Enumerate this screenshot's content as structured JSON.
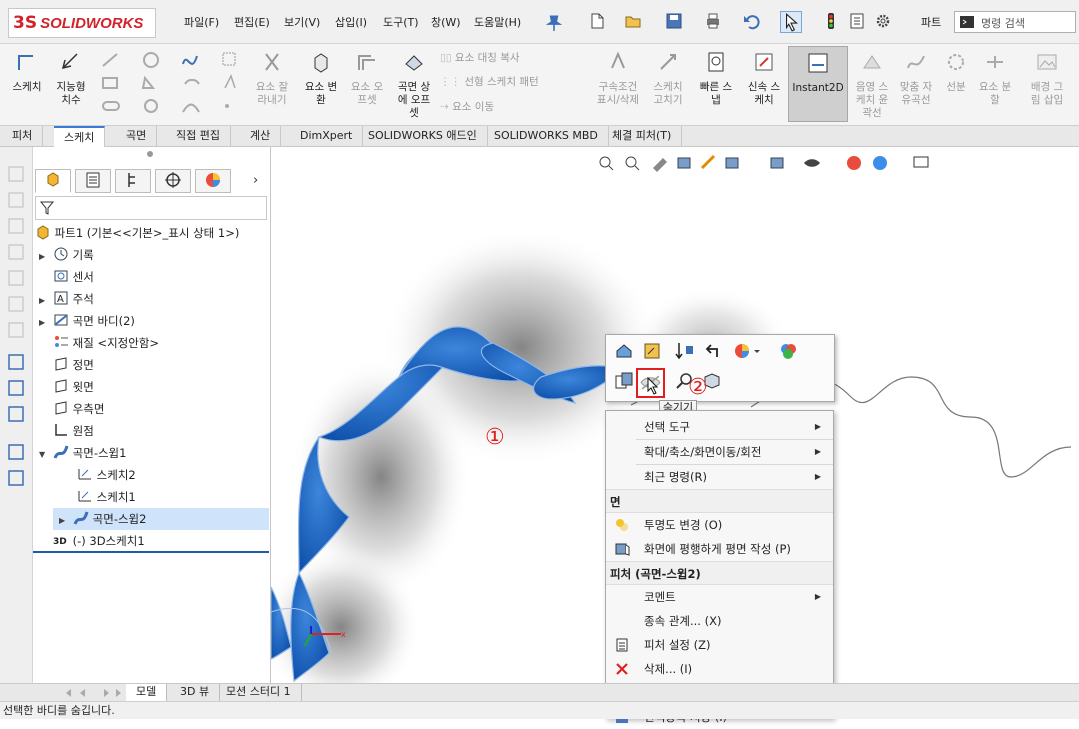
{
  "app": {
    "brand": "SOLIDWORKS",
    "brand_prefix": "3S"
  },
  "menu": [
    "파일(F)",
    "편집(E)",
    "보기(V)",
    "삽입(I)",
    "도구(T)",
    "창(W)",
    "도움말(H)"
  ],
  "titlebar": {
    "doc_type": "파트",
    "search_placeholder": "명령 검색"
  },
  "ribbon": {
    "sketch": "스케치",
    "smart_dim": [
      "지능형",
      "치수"
    ],
    "trim": [
      "요소 잘",
      "라내기"
    ],
    "convert": [
      "요소 변",
      "환"
    ],
    "offset": [
      "요소 오",
      "프셋"
    ],
    "surface_offset": [
      "곡면 상",
      "에 오프",
      "셋"
    ],
    "mirror": "요소 대칭 복사",
    "linear_pattern": "선형 스케치 패턴",
    "move": "요소 이동",
    "relations": [
      "구속조건",
      "표시/삭제"
    ],
    "repair": [
      "스케치",
      "고치기"
    ],
    "quick_snap": [
      "빠른 스",
      "냅"
    ],
    "rapid_sketch": [
      "신속 스",
      "케치"
    ],
    "instant2d": "Instant2D",
    "shaded_contour": [
      "음영 스",
      "케치 윤",
      "곽선"
    ],
    "fit_spline": [
      "맞춤 자",
      "유곡선"
    ],
    "segment": "선분",
    "split_entity": [
      "요소 분",
      "할"
    ],
    "sketch_picture": [
      "배경 그",
      "림 삽입"
    ]
  },
  "tabs": [
    "피처",
    "스케치",
    "곡면",
    "직접 편집",
    "계산",
    "DimXpert",
    "SOLIDWORKS 애드인",
    "SOLIDWORKS MBD",
    "체결 피처(T)"
  ],
  "tree": {
    "root": "파트1  (기본<<기본>_표시 상태 1>)",
    "items": [
      {
        "label": "기록",
        "icon": "history-icon",
        "expand": true
      },
      {
        "label": "센서",
        "icon": "sensor-icon",
        "expand": false
      },
      {
        "label": "주석",
        "icon": "annotation-icon",
        "expand": true
      },
      {
        "label": "곡면 바디(2)",
        "icon": "surface-bodies-icon",
        "expand": true
      },
      {
        "label": "재질 <지정안함>",
        "icon": "material-icon",
        "expand": false
      },
      {
        "label": "정면",
        "icon": "plane-icon",
        "expand": false
      },
      {
        "label": "윗면",
        "icon": "plane-icon",
        "expand": false
      },
      {
        "label": "우측면",
        "icon": "plane-icon",
        "expand": false
      },
      {
        "label": "원점",
        "icon": "origin-icon",
        "expand": false
      },
      {
        "label": "곡면-스윕1",
        "icon": "surface-sweep-icon",
        "expand": "open"
      },
      {
        "label": "스케치2",
        "icon": "sketch-icon",
        "child": true
      },
      {
        "label": "스케치1",
        "icon": "sketch-icon",
        "child": true
      },
      {
        "label": "곡면-스윕2",
        "icon": "surface-sweep-icon",
        "expand": true,
        "selected": true
      },
      {
        "label": "(-) 3D스케치1",
        "icon": "3d-sketch-icon",
        "expand": false
      }
    ]
  },
  "bottom_tabs": [
    "모델",
    "3D 뷰",
    "모션 스터디 1"
  ],
  "status": "선택한 바디를 숨깁니다.",
  "annotations": {
    "one": "①",
    "two": "②"
  },
  "tooltip": "숨기기",
  "ctx_menu": {
    "items1": [
      {
        "label": "선택 도구",
        "arrow": true
      },
      {
        "label": "확대/축소/화면이동/회전",
        "arrow": true
      },
      {
        "label": "최근 명령(R)",
        "arrow": true
      }
    ],
    "header_face": "면",
    "face_items": [
      {
        "label": "투명도 변경 (O)",
        "icon": "transparency-icon"
      },
      {
        "label": "화면에 평행하게 평면 작성 (P)",
        "icon": "plane-parallel-icon"
      }
    ],
    "header_feature": "피처 (곡면-스윕2)",
    "feature_items": [
      {
        "label": "코멘트",
        "arrow": true,
        "icon": ""
      },
      {
        "label": "종속 관계... (X)",
        "icon": ""
      },
      {
        "label": "피처 설정 (Z)",
        "icon": "feature-settings-icon"
      },
      {
        "label": "삭제... (I)",
        "icon": "delete-icon"
      },
      {
        "label": "즐겨찾기에 추가 (W)",
        "icon": "favorites-icon"
      },
      {
        "label": "선택항목 저장 (I)",
        "icon": "save-selection-icon"
      }
    ]
  },
  "colors": {
    "accent": "#1565c0",
    "highlight": "#e02020",
    "brand": "#d2232a"
  }
}
